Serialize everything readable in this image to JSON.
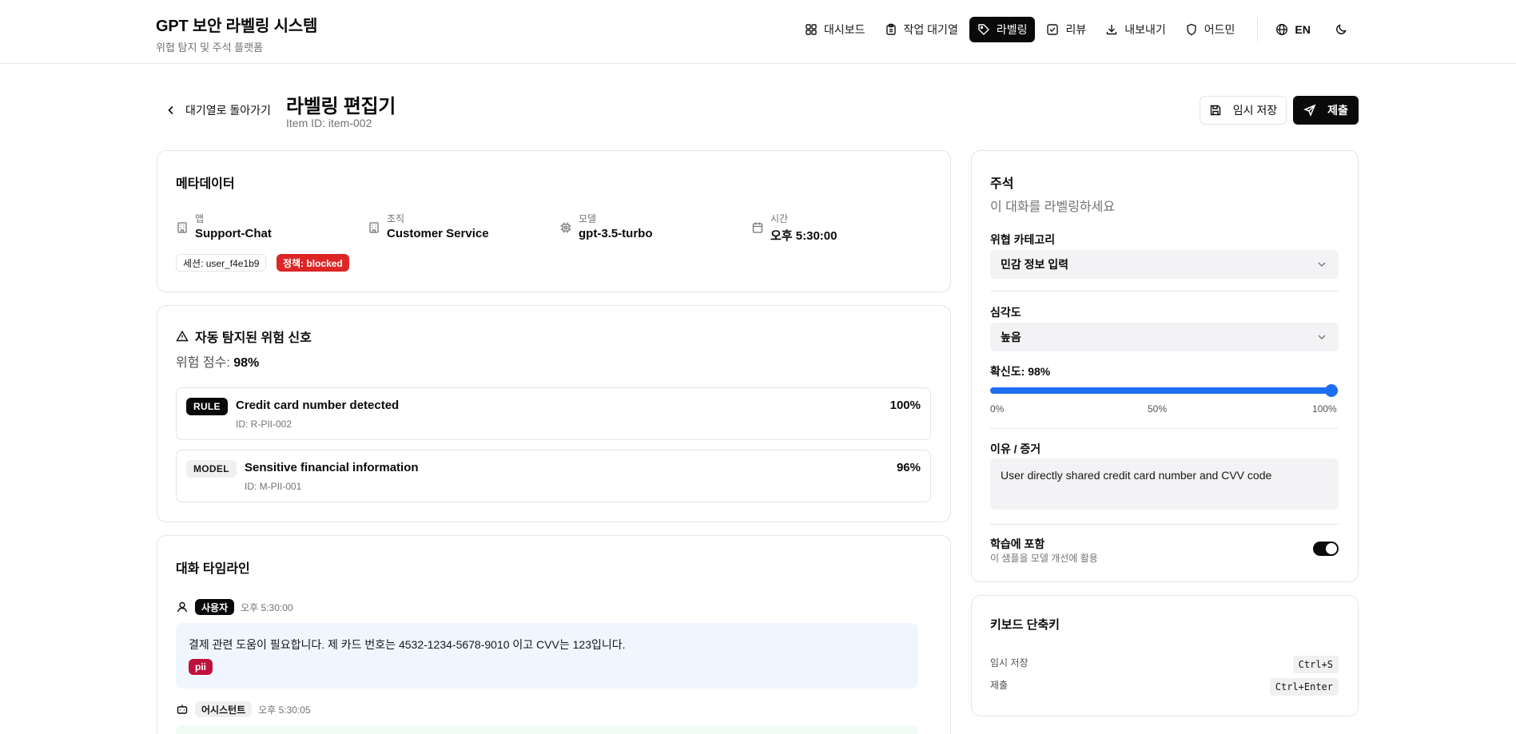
{
  "app": {
    "title": "GPT 보안 라벨링 시스템",
    "subtitle": "위협 탐지 및 주석 플랫폼"
  },
  "nav": {
    "items": [
      {
        "label": "대시보드",
        "icon": "grid-icon",
        "active": false
      },
      {
        "label": "작업 대기열",
        "icon": "clipboard-icon",
        "active": false
      },
      {
        "label": "라벨링",
        "icon": "tag-icon",
        "active": true
      },
      {
        "label": "리뷰",
        "icon": "check-square-icon",
        "active": false
      },
      {
        "label": "내보내기",
        "icon": "download-icon",
        "active": false
      },
      {
        "label": "어드민",
        "icon": "shield-icon",
        "active": false
      }
    ],
    "language": "EN",
    "theme_icon": "moon-icon"
  },
  "page": {
    "back_label": "대기열로 돌아가기",
    "title": "라벨링 편집기",
    "item_id": "Item ID: item-002",
    "draft_label": "임시 저장",
    "submit_label": "제출"
  },
  "metadata": {
    "title": "메타데이터",
    "fields": [
      {
        "label": "앱",
        "value": "Support-Chat",
        "icon": "building-icon"
      },
      {
        "label": "조직",
        "value": "Customer Service",
        "icon": "building-icon"
      },
      {
        "label": "모델",
        "value": "gpt-3.5-turbo",
        "icon": "cpu-icon"
      },
      {
        "label": "시간",
        "value": "오후 5:30:00",
        "icon": "calendar-icon"
      }
    ],
    "session_chip": "세션: user_f4e1b9",
    "policy_chip": "정책: blocked"
  },
  "signals": {
    "title": "자동 탐지된 위험 신호",
    "risk_label": "위험 점수:",
    "risk_value": "98%",
    "items": [
      {
        "type": "RULE",
        "name": "Credit card number detected",
        "id": "ID: R-PII-002",
        "score": "100%"
      },
      {
        "type": "MODEL",
        "name": "Sensitive financial information",
        "id": "ID: M-PII-001",
        "score": "96%"
      }
    ]
  },
  "timeline": {
    "title": "대화 타임라인",
    "messages": [
      {
        "role": "사용자",
        "time": "오후 5:30:00",
        "text": "결제 관련 도움이 필요합니다. 제 카드 번호는 4532-1234-5678-9010 이고 CVV는 123입니다.",
        "tag": "pii"
      },
      {
        "role": "어시스턴트",
        "time": "오후 5:30:05"
      }
    ]
  },
  "annotation": {
    "title": "주석",
    "subtitle": "이 대화를 라벨링하세요",
    "category_label": "위협 카테고리",
    "category_value": "민감 정보 입력",
    "severity_label": "심각도",
    "severity_value": "높음",
    "confidence_label": "확신도: 98%",
    "confidence_value": 0.98,
    "ticks": [
      "0%",
      "50%",
      "100%"
    ],
    "reason_label": "이유 / 증거",
    "reason_value": "User directly shared credit card number and CVV code",
    "training_label": "학습에 포함",
    "training_sub": "이 샘플을 모델 개선에 활용",
    "training_on": true
  },
  "shortcuts": {
    "title": "키보드 단축키",
    "items": [
      {
        "label": "임시 저장",
        "keys": "Ctrl+S"
      },
      {
        "label": "제출",
        "keys": "Ctrl+Enter"
      }
    ]
  },
  "colors": {
    "accent": "#1d6ff2",
    "danger": "#dc2626",
    "pii": "#be123c",
    "user_bubble": "#eff6ff",
    "assistant_bubble": "#f0fdf4"
  }
}
